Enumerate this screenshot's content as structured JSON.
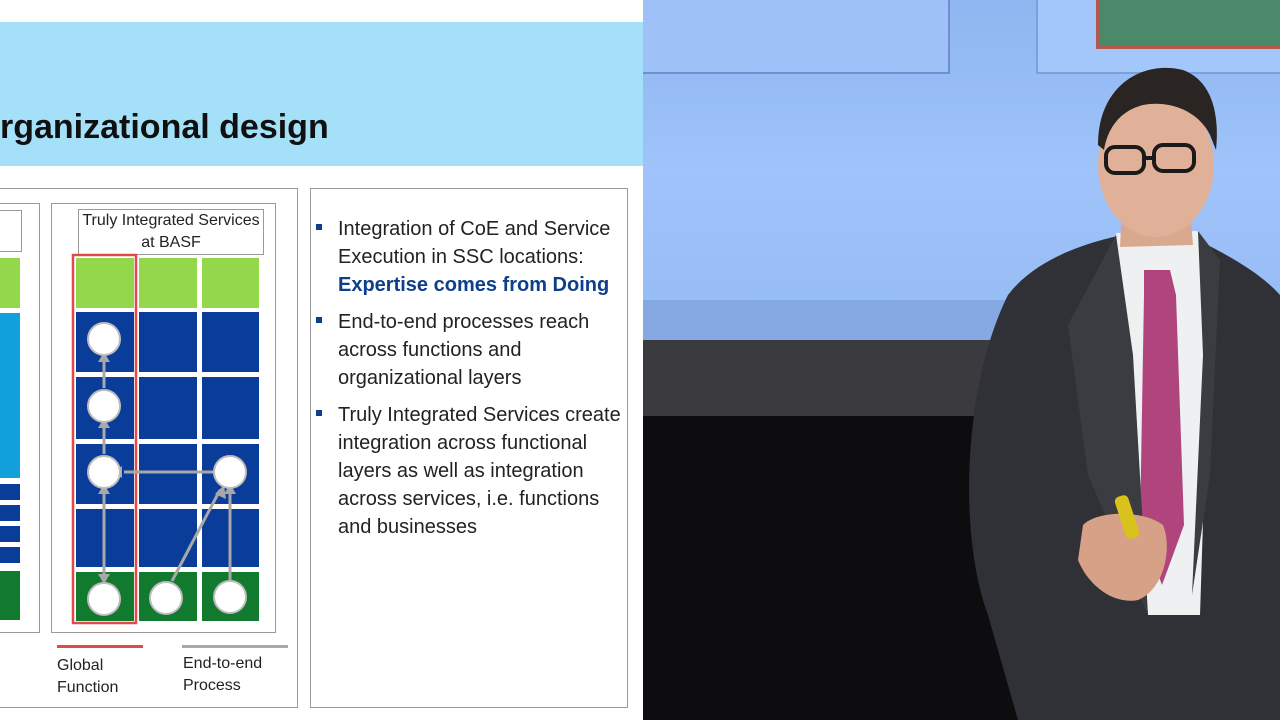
{
  "slide": {
    "title": "rganizational design",
    "tis_header": "Truly Integrated Services at BASF",
    "legend": {
      "global": "Global Function",
      "e2e": "End-to-end Process"
    },
    "bullets": [
      {
        "text": "Integration of CoE and Service Execution in SSC locations:",
        "highlight": "Expertise comes from Doing"
      },
      {
        "text": "End-to-end processes reach across functions and organizational layers",
        "highlight": ""
      },
      {
        "text": "Truly Integrated Services create integration across functional layers as well as integration across services, i.e. functions and businesses",
        "highlight": ""
      }
    ]
  },
  "colors": {
    "title_band": "#a4e0f8",
    "accent_blue": "#0d3f8c",
    "grid_blue": "#0a3d99",
    "top_green": "#92d84a",
    "bottom_green": "#127a2f",
    "global_red": "#e04a4a",
    "process_gray": "#a8a8a8"
  }
}
